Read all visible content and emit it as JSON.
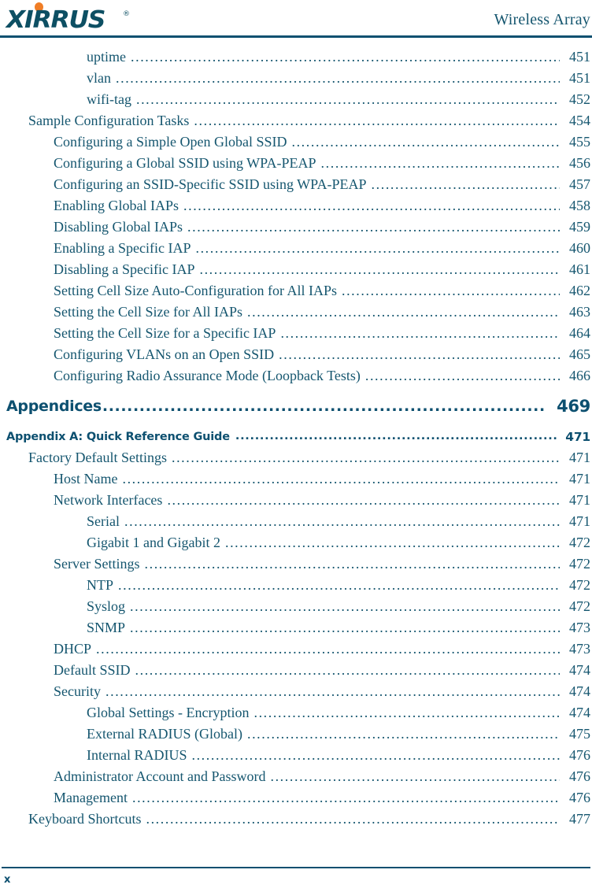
{
  "header": {
    "logo_text": "XIRRUS",
    "logo_trademark": "®",
    "title": "Wireless Array"
  },
  "toc": {
    "entries": [
      {
        "label": "uptime",
        "page": "451",
        "level": 3,
        "style": "normal"
      },
      {
        "label": "vlan",
        "page": "451",
        "level": 3,
        "style": "normal"
      },
      {
        "label": "wifi-tag",
        "page": "452",
        "level": 3,
        "style": "normal"
      },
      {
        "label": "Sample Configuration Tasks",
        "page": "454",
        "level": 1,
        "style": "normal"
      },
      {
        "label": "Configuring a Simple Open Global SSID",
        "page": "455",
        "level": 2,
        "style": "normal"
      },
      {
        "label": "Configuring a Global SSID using WPA-PEAP",
        "page": "456",
        "level": 2,
        "style": "normal"
      },
      {
        "label": "Configuring an SSID-Specific SSID using WPA-PEAP",
        "page": "457",
        "level": 2,
        "style": "normal"
      },
      {
        "label": "Enabling Global IAPs",
        "page": "458",
        "level": 2,
        "style": "normal"
      },
      {
        "label": "Disabling Global IAPs",
        "page": "459",
        "level": 2,
        "style": "normal"
      },
      {
        "label": "Enabling a Specific IAP",
        "page": "460",
        "level": 2,
        "style": "normal"
      },
      {
        "label": "Disabling a Specific IAP",
        "page": "461",
        "level": 2,
        "style": "normal"
      },
      {
        "label": "Setting Cell Size Auto-Configuration for All IAPs",
        "page": "462",
        "level": 2,
        "style": "normal"
      },
      {
        "label": "Setting the Cell Size for All IAPs",
        "page": "463",
        "level": 2,
        "style": "normal"
      },
      {
        "label": "Setting the Cell Size for a Specific IAP",
        "page": "464",
        "level": 2,
        "style": "normal"
      },
      {
        "label": "Configuring VLANs on an Open SSID",
        "page": "465",
        "level": 2,
        "style": "normal"
      },
      {
        "label": "Configuring Radio Assurance Mode (Loopback Tests)",
        "page": "466",
        "level": 2,
        "style": "normal"
      },
      {
        "label": "Appendices",
        "page": "469",
        "level": 0,
        "style": "major"
      },
      {
        "label": "Appendix A: Quick Reference Guide",
        "page": "471",
        "level": 0,
        "style": "minor"
      },
      {
        "label": "Factory Default Settings",
        "page": "471",
        "level": 1,
        "style": "normal"
      },
      {
        "label": "Host Name",
        "page": "471",
        "level": 2,
        "style": "normal"
      },
      {
        "label": "Network Interfaces",
        "page": "471",
        "level": 2,
        "style": "normal"
      },
      {
        "label": "Serial",
        "page": "471",
        "level": 3,
        "style": "normal"
      },
      {
        "label": "Gigabit 1 and Gigabit 2",
        "page": "472",
        "level": 3,
        "style": "normal"
      },
      {
        "label": "Server Settings",
        "page": "472",
        "level": 2,
        "style": "normal"
      },
      {
        "label": "NTP",
        "page": "472",
        "level": 3,
        "style": "normal"
      },
      {
        "label": "Syslog",
        "page": "472",
        "level": 3,
        "style": "normal"
      },
      {
        "label": "SNMP",
        "page": "473",
        "level": 3,
        "style": "normal"
      },
      {
        "label": "DHCP",
        "page": "473",
        "level": 2,
        "style": "normal"
      },
      {
        "label": "Default SSID",
        "page": "474",
        "level": 2,
        "style": "normal"
      },
      {
        "label": "Security",
        "page": "474",
        "level": 2,
        "style": "normal"
      },
      {
        "label": "Global Settings - Encryption",
        "page": "474",
        "level": 3,
        "style": "normal"
      },
      {
        "label": "External RADIUS (Global)",
        "page": "475",
        "level": 3,
        "style": "normal"
      },
      {
        "label": "Internal RADIUS",
        "page": "476",
        "level": 3,
        "style": "normal"
      },
      {
        "label": "Administrator Account and Password",
        "page": "476",
        "level": 2,
        "style": "normal"
      },
      {
        "label": "Management",
        "page": "476",
        "level": 2,
        "style": "normal"
      },
      {
        "label": "Keyboard Shortcuts",
        "page": "477",
        "level": 1,
        "style": "normal"
      }
    ]
  },
  "footer": {
    "page_number": "x"
  },
  "colors": {
    "text_teal": "#15566f",
    "rule_teal": "#0d5070",
    "logo_teal": "#0d4f63",
    "logo_accent_orange": "#f07e26"
  }
}
